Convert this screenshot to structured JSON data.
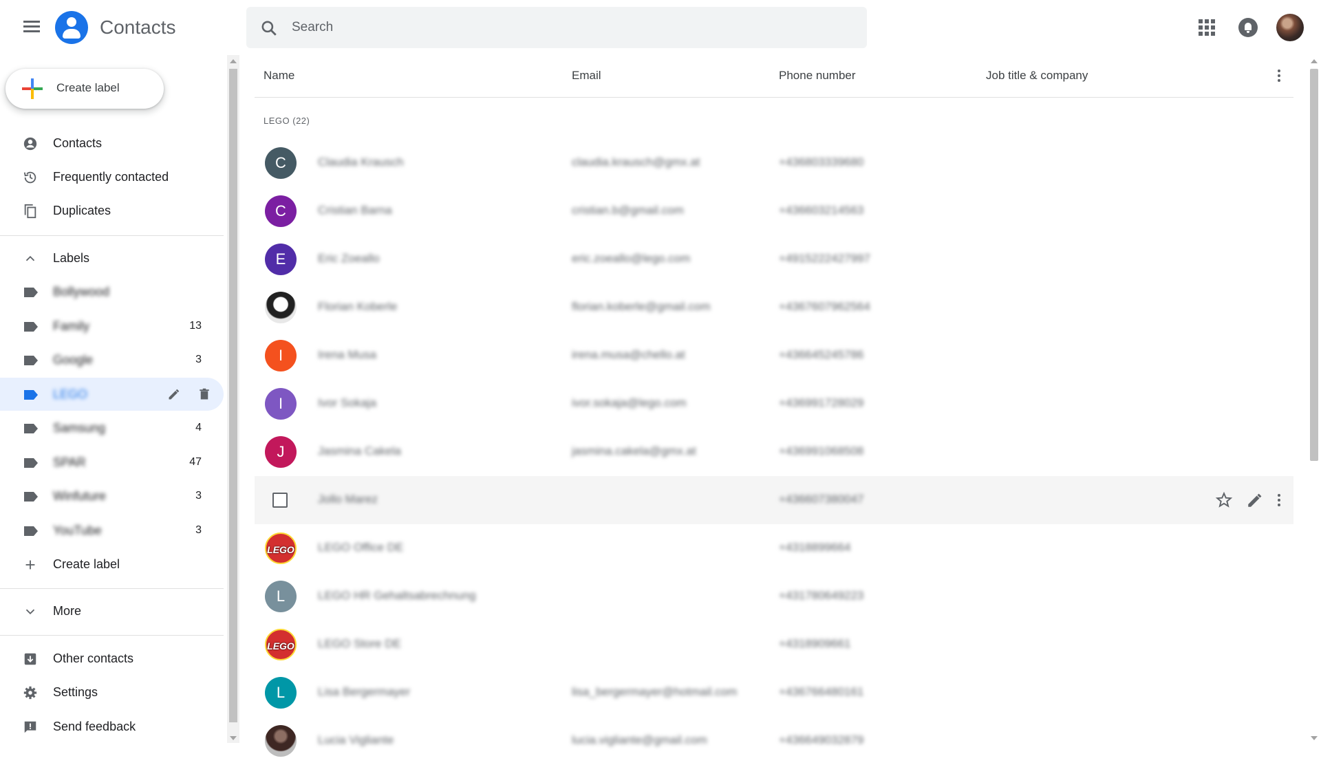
{
  "header": {
    "app_title": "Contacts",
    "search_placeholder": "Search"
  },
  "sidebar": {
    "create_label": "Create label",
    "nav": [
      {
        "label": "Contacts",
        "icon": "person-circle-icon"
      },
      {
        "label": "Frequently contacted",
        "icon": "history-icon"
      },
      {
        "label": "Duplicates",
        "icon": "copy-icon"
      }
    ],
    "labels_heading": "Labels",
    "labels": [
      {
        "name": "Bollywood",
        "count": ""
      },
      {
        "name": "Family",
        "count": "13"
      },
      {
        "name": "Google",
        "count": "3"
      },
      {
        "name": "LEGO",
        "count": "",
        "active": true
      },
      {
        "name": "Samsung",
        "count": "4"
      },
      {
        "name": "SPAR",
        "count": "47"
      },
      {
        "name": "Winfuture",
        "count": "3"
      },
      {
        "name": "YouTube",
        "count": "3"
      }
    ],
    "more": "More",
    "bottom": [
      {
        "label": "Other contacts",
        "icon": "archive-icon"
      },
      {
        "label": "Settings",
        "icon": "gear-icon"
      },
      {
        "label": "Send feedback",
        "icon": "feedback-icon"
      }
    ]
  },
  "table": {
    "columns": [
      "Name",
      "Email",
      "Phone number",
      "Job title & company"
    ],
    "group_label": "LEGO (22)",
    "rows": [
      {
        "initial": "C",
        "color": "#455a64",
        "name": "Claudia Krausch",
        "email": "claudia.krausch@gmx.at",
        "phone": "+436803339680"
      },
      {
        "initial": "C",
        "color": "#7b1fa2",
        "name": "Cristian Barna",
        "email": "cristian.b@gmail.com",
        "phone": "+436603214563"
      },
      {
        "initial": "E",
        "color": "#512da8",
        "name": "Eric Zoeallo",
        "email": "eric.zoeallo@lego.com",
        "phone": "+4915222427997"
      },
      {
        "initial": "",
        "color": "",
        "avatar_type": "photo-penguin",
        "name": "Florian Koberle",
        "email": "florian.koberle@gmail.com",
        "phone": "+4367607962564"
      },
      {
        "initial": "I",
        "color": "#f4511e",
        "name": "Irena Musa",
        "email": "irena.musa@chello.at",
        "phone": "+436645245786"
      },
      {
        "initial": "I",
        "color": "#7e57c2",
        "name": "Ivor Sokaja",
        "email": "ivor.sokaja@lego.com",
        "phone": "+436991728029"
      },
      {
        "initial": "J",
        "color": "#c2185b",
        "name": "Jasmina Cakela",
        "email": "jasmina.cakela@gmx.at",
        "phone": "+436991068508"
      },
      {
        "initial": "",
        "color": "",
        "avatar_type": "checkbox",
        "name": "Jollo Marez",
        "email": "",
        "phone": "+436607380047",
        "hover": true
      },
      {
        "initial": "LEGO",
        "color": "#d32f2f",
        "avatar_type": "lego",
        "name": "LEGO Office DE",
        "email": "",
        "phone": "+4318899664"
      },
      {
        "initial": "L",
        "color": "#78909c",
        "name": "LEGO HR Gehaltsabrechnung",
        "email": "",
        "phone": "+431780649223"
      },
      {
        "initial": "LEGO",
        "color": "#d32f2f",
        "avatar_type": "lego",
        "name": "LEGO Store DE",
        "email": "",
        "phone": "+4318909661"
      },
      {
        "initial": "L",
        "color": "#0097a7",
        "name": "Lisa Bergermayer",
        "email": "lisa_bergermayer@hotmail.com",
        "phone": "+436766480161"
      },
      {
        "initial": "",
        "color": "",
        "avatar_type": "photo-person",
        "name": "Lucia Vigliante",
        "email": "lucia.vigliante@gmail.com",
        "phone": "+436649032879"
      }
    ]
  }
}
